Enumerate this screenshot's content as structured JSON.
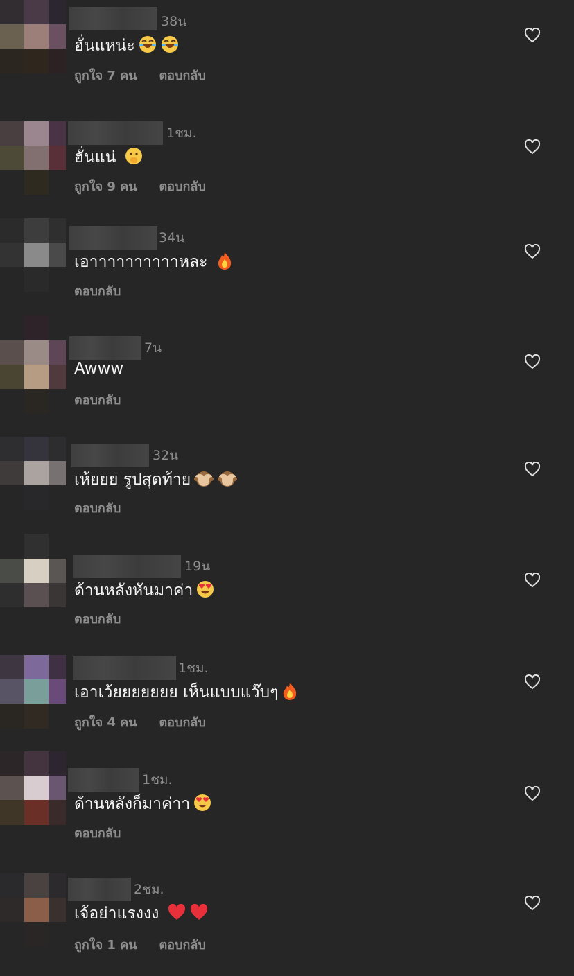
{
  "comments": [
    {
      "time": "38น",
      "text": "ฮั่นแหน่ะ",
      "emoji": [
        "laugh",
        "laugh"
      ],
      "likes": "ถูกใจ 7 คน",
      "reply": "ตอบกลับ"
    },
    {
      "time": "1ชม.",
      "text": "ฮั่นแน่",
      "emoji": [
        "shush"
      ],
      "likes": "ถูกใจ 9 คน",
      "reply": "ตอบกลับ"
    },
    {
      "time": "34น",
      "text": "เอาาาาาาาาาาหละ",
      "emoji": [
        "fire"
      ],
      "likes": "",
      "reply": "ตอบกลับ"
    },
    {
      "time": "7น",
      "text": "Awww",
      "emoji": [],
      "likes": "",
      "reply": "ตอบกลับ"
    },
    {
      "time": "32น",
      "text": "เห้ยยย รูปสุดท้าย",
      "emoji": [
        "monkey",
        "monkey"
      ],
      "likes": "",
      "reply": "ตอบกลับ"
    },
    {
      "time": "19น",
      "text": "ด้านหลังหันมาค่า",
      "emoji": [
        "hearteyes"
      ],
      "likes": "",
      "reply": "ตอบกลับ"
    },
    {
      "time": "1ชม.",
      "text": "เอาเว้ยยยยยยย เห็นแบบแว๊บๆ",
      "emoji": [
        "fire"
      ],
      "likes": "ถูกใจ 4 คน",
      "reply": "ตอบกลับ"
    },
    {
      "time": "1ชม.",
      "text": "ด้านหลังก็มาค่าา",
      "emoji": [
        "hearteyes"
      ],
      "likes": "",
      "reply": "ตอบกลับ"
    },
    {
      "time": "2ชม.",
      "text": "เจ้อย่าแรงงง",
      "emoji": [
        "redheart",
        "redheart"
      ],
      "likes": "ถูกใจ 1 คน",
      "reply": "ตอบกลับ"
    }
  ]
}
